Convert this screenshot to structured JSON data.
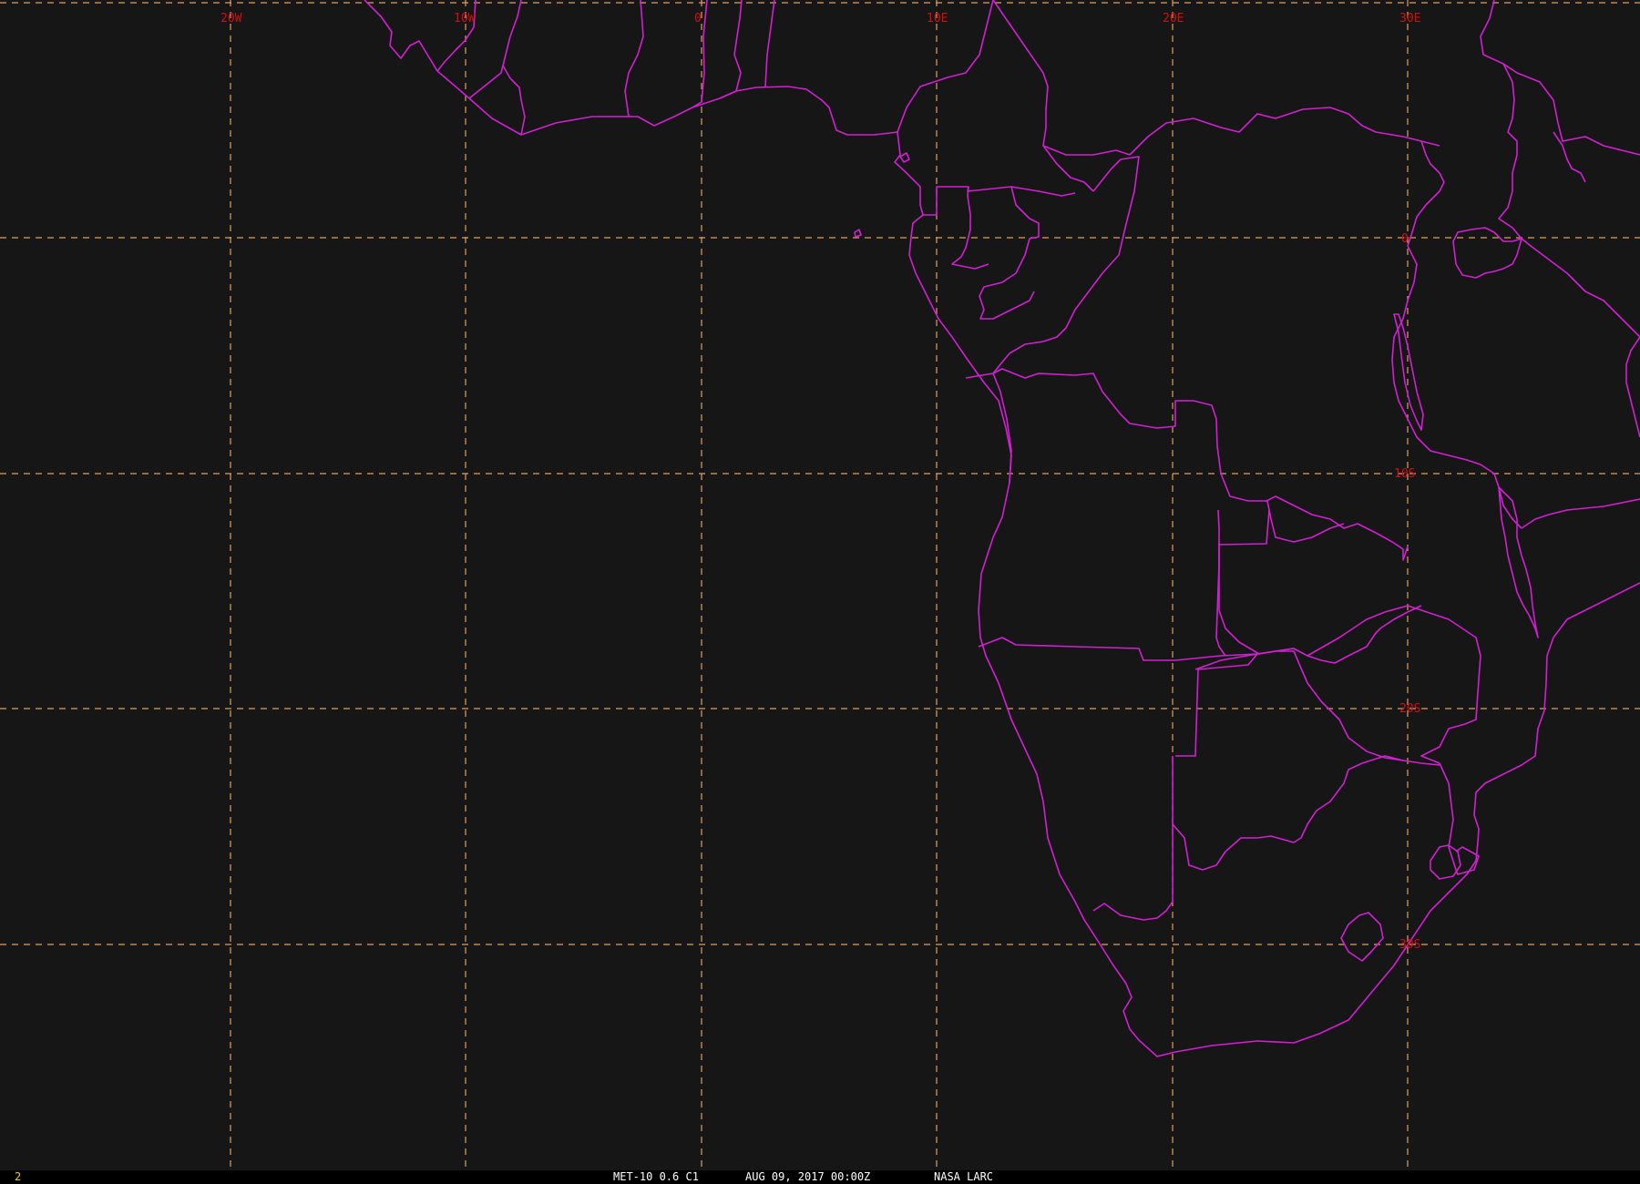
{
  "colors": {
    "background": "#161616",
    "grid_lines": "#e0a060",
    "grid_labels": "#d01010",
    "borders": "#d21fd2",
    "status_bar": "#000000",
    "status_text": "#ffffff",
    "frame_number": "#e8d200"
  },
  "map": {
    "longitude_labels": [
      "20W",
      "10W",
      "0",
      "10E",
      "20E",
      "30E"
    ],
    "latitude_labels": [
      "0",
      "10S",
      "20S",
      "30S"
    ]
  },
  "status_bar": {
    "frame_number": "2",
    "product": "MET-10 0.6 C1",
    "timestamp": "AUG 09, 2017 00:00Z",
    "source": "NASA LARC"
  }
}
